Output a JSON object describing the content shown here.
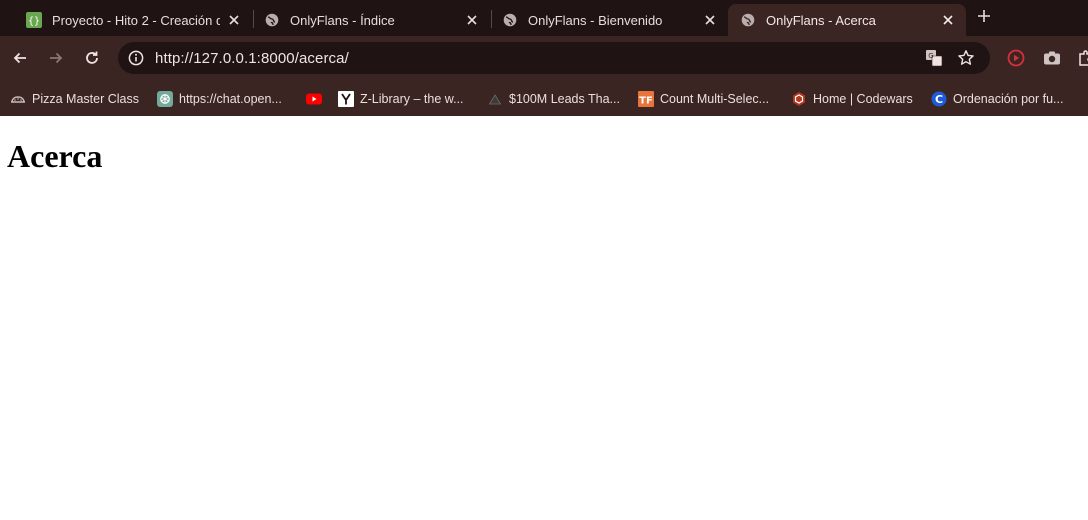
{
  "tabs": [
    {
      "title": "Proyecto - Hito 2 - Creación d",
      "favicon": "code-braces-icon",
      "active": false
    },
    {
      "title": "OnlyFlans - Índice",
      "favicon": "globe-icon",
      "active": false
    },
    {
      "title": "OnlyFlans - Bienvenido",
      "favicon": "globe-icon",
      "active": false
    },
    {
      "title": "OnlyFlans - Acerca",
      "favicon": "globe-icon",
      "active": true
    }
  ],
  "address_bar": {
    "url": "http://127.0.0.1:8000/acerca/"
  },
  "bookmarks": [
    {
      "label": "Pizza Master Class",
      "icon": "pizza-icon"
    },
    {
      "label": "https://chat.open...",
      "icon": "openai-icon"
    },
    {
      "label": "",
      "icon": "youtube-icon"
    },
    {
      "label": "Z-Library – the w...",
      "icon": "zlibrary-icon"
    },
    {
      "label": "$100M Leads Tha...",
      "icon": "triangle-icon"
    },
    {
      "label": "Count Multi-Selec...",
      "icon": "tf-icon"
    },
    {
      "label": "Home | Codewars",
      "icon": "codewars-icon"
    },
    {
      "label": "Ordenación por fu...",
      "icon": "c-icon"
    }
  ],
  "page": {
    "heading": "Acerca"
  },
  "colors": {
    "tabstrip": "#1f1413",
    "toolbar": "#3a2523",
    "omnibox": "#1f1413",
    "text": "#efe4e2"
  }
}
